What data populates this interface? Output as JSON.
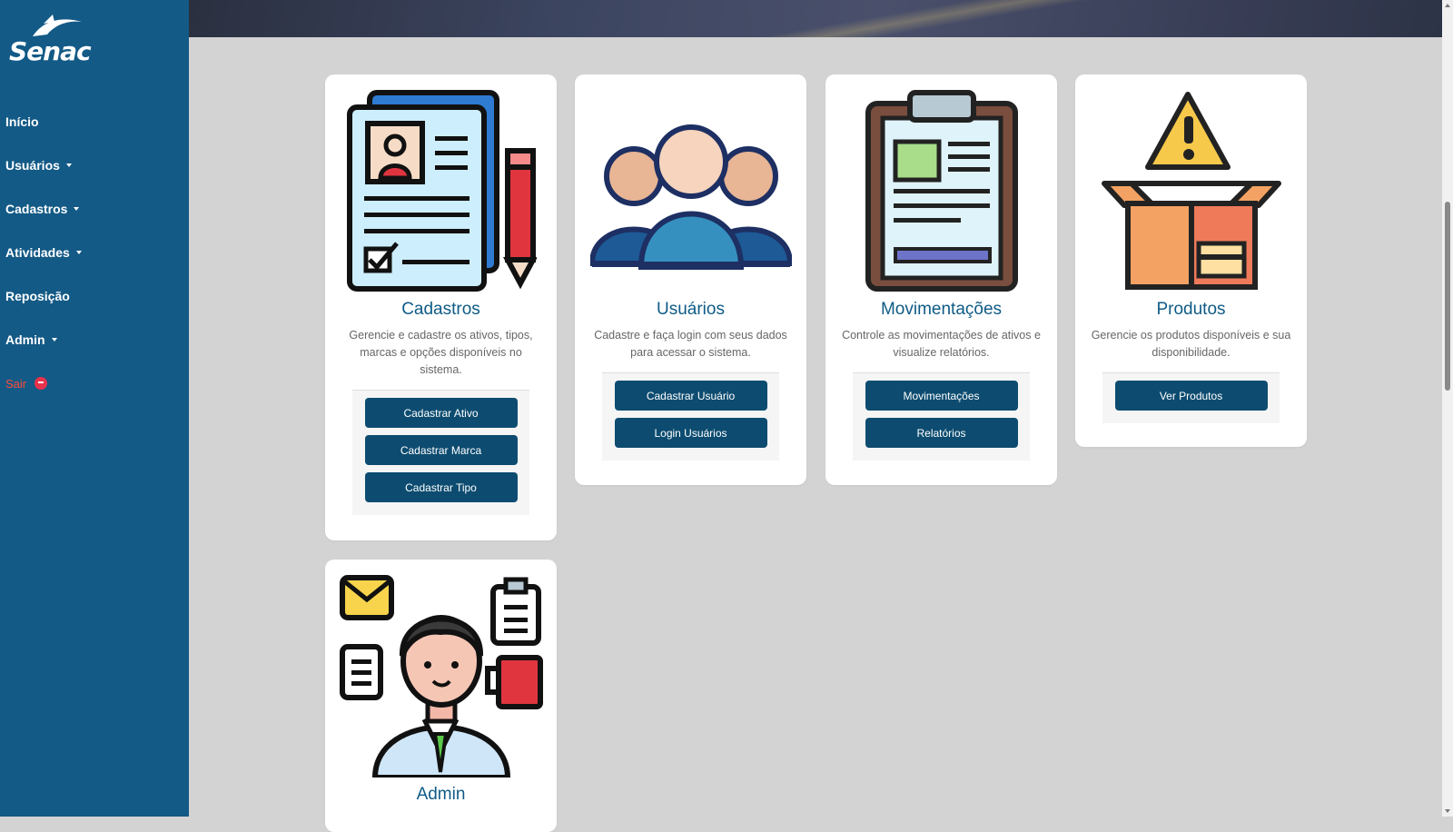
{
  "brand": {
    "logo_text": "Senac"
  },
  "nav": {
    "items": [
      {
        "label": "Início"
      },
      {
        "label": "Usuários"
      },
      {
        "label": "Cadastros"
      },
      {
        "label": "Atividades"
      },
      {
        "label": "Reposição"
      },
      {
        "label": "Admin"
      }
    ],
    "logout": "Sair"
  },
  "cards": {
    "cadastros": {
      "title": "Cadastros",
      "description": "Gerencie e cadastre os ativos, tipos, marcas e opções disponíveis no sistema.",
      "buttons": [
        "Cadastrar Ativo",
        "Cadastrar Marca",
        "Cadastrar Tipo"
      ]
    },
    "usuarios": {
      "title": "Usuários",
      "description": "Cadastre e faça login com seus dados para acessar o sistema.",
      "buttons": [
        "Cadastrar Usuário",
        "Login Usuários"
      ]
    },
    "movimentacoes": {
      "title": "Movimentações",
      "description": "Controle as movimentações de ativos e visualize relatórios.",
      "buttons": [
        "Movimentações",
        "Relatórios"
      ]
    },
    "produtos": {
      "title": "Produtos",
      "description": "Gerencie os produtos disponíveis e sua disponibilidade.",
      "buttons": [
        "Ver Produtos"
      ]
    },
    "admin": {
      "title": "Admin"
    }
  },
  "colors": {
    "sidebar": "#135a86",
    "button": "#0d4c70",
    "title": "#0f5b86",
    "logout": "#ff4b3a"
  }
}
